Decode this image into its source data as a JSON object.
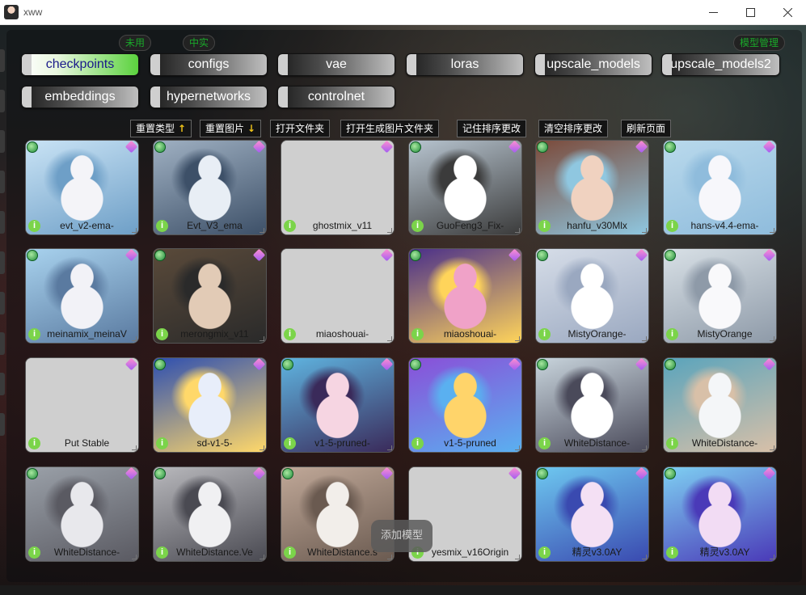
{
  "window": {
    "title": "xww"
  },
  "top_pills": [
    "未用",
    "中实",
    "模型管理"
  ],
  "categories": [
    {
      "label": "checkpoints",
      "active": true
    },
    {
      "label": "configs",
      "active": false
    },
    {
      "label": "vae",
      "active": false
    },
    {
      "label": "loras",
      "active": false
    },
    {
      "label": "upscale_models",
      "active": false
    },
    {
      "label": "upscale_models2",
      "active": false
    },
    {
      "label": "embeddings",
      "active": false
    },
    {
      "label": "hypernetworks",
      "active": false
    },
    {
      "label": "controlnet",
      "active": false
    }
  ],
  "toolbar": {
    "reset_type": "重置类型",
    "reset_type_arrow": "↑",
    "reset_image": "重置图片",
    "reset_image_arrow": "↓",
    "open_folder": "打开文件夹",
    "open_gen_folder": "打开生成图片文件夹",
    "save_order": "记住排序更改",
    "clear_order": "清空排序更改",
    "refresh": "刷新页面"
  },
  "models": [
    {
      "name": "evt_v2-ema-",
      "has_image": true,
      "colors": [
        "#c9e3f5",
        "#f4f4f8",
        "#6e9fc7"
      ]
    },
    {
      "name": "Evt_V3_ema",
      "has_image": true,
      "colors": [
        "#9fb0c2",
        "#e8eef5",
        "#3d5068"
      ]
    },
    {
      "name": "ghostmix_v11",
      "has_image": false,
      "colors": []
    },
    {
      "name": "GuoFeng3_Fix-",
      "has_image": true,
      "colors": [
        "#b7c4cf",
        "#ffffff",
        "#3b3b3b"
      ]
    },
    {
      "name": "hanfu_v30Mlx",
      "has_image": true,
      "colors": [
        "#7b4a3a",
        "#f0d2c0",
        "#8fc7e0"
      ]
    },
    {
      "name": "hans-v4.4-ema-",
      "has_image": true,
      "colors": [
        "#b9d9ec",
        "#f7f7fb",
        "#8fbcdc"
      ]
    },
    {
      "name": "meinamix_meinaV",
      "has_image": true,
      "colors": [
        "#a8d2ee",
        "#f2f2f7",
        "#5a7aa0"
      ]
    },
    {
      "name": "merongmix_v11",
      "has_image": true,
      "colors": [
        "#5a4a3a",
        "#e2cbb6",
        "#2a2a2a"
      ]
    },
    {
      "name": "miaoshouai-",
      "has_image": false,
      "colors": []
    },
    {
      "name": "miaoshouai-",
      "has_image": true,
      "colors": [
        "#4a2f8a",
        "#f0a2c8",
        "#ffd45a"
      ]
    },
    {
      "name": "MistyOrange-",
      "has_image": true,
      "colors": [
        "#d6dde8",
        "#ffffff",
        "#9aa8c0"
      ]
    },
    {
      "name": "MistyOrange",
      "has_image": true,
      "colors": [
        "#d8e0e6",
        "#f9f9fb",
        "#8e9aa8"
      ]
    },
    {
      "name": "Put Stable",
      "has_image": false,
      "colors": []
    },
    {
      "name": "sd-v1-5-",
      "has_image": true,
      "colors": [
        "#2e4fb0",
        "#e8eefa",
        "#ffd86a"
      ]
    },
    {
      "name": "v1-5-pruned-",
      "has_image": true,
      "colors": [
        "#5fb4e0",
        "#f6d5e2",
        "#3a2a5a"
      ]
    },
    {
      "name": "v1-5-pruned",
      "has_image": true,
      "colors": [
        "#8a4fd8",
        "#ffd46a",
        "#5ab0f0"
      ]
    },
    {
      "name": "WhiteDistance-",
      "has_image": true,
      "colors": [
        "#c8d4dc",
        "#ffffff",
        "#4a4a5a"
      ]
    },
    {
      "name": "WhiteDistance-",
      "has_image": true,
      "colors": [
        "#5aa4bc",
        "#f4f6f8",
        "#d8c0a8"
      ]
    },
    {
      "name": "WhiteDistance-",
      "has_image": true,
      "colors": [
        "#9aa0a8",
        "#e8e8ec",
        "#5a5a62"
      ]
    },
    {
      "name": "WhiteDistance.Ve",
      "has_image": true,
      "colors": [
        "#b8b8bc",
        "#f0f0f2",
        "#4a4a52"
      ]
    },
    {
      "name": "WhiteDistance.s",
      "has_image": true,
      "colors": [
        "#c0a898",
        "#f2eeea",
        "#6a5a50"
      ]
    },
    {
      "name": "yesmix_v16Origin",
      "has_image": false,
      "colors": []
    },
    {
      "name": "精灵v3.0AY",
      "has_image": true,
      "colors": [
        "#6ec8f0",
        "#f4e0f4",
        "#3a4ab0"
      ]
    },
    {
      "name": "精灵v3.0AY",
      "has_image": true,
      "colors": [
        "#7ecff2",
        "#f2dcf4",
        "#4a3ab8"
      ]
    }
  ],
  "add_model_label": "添加模型"
}
